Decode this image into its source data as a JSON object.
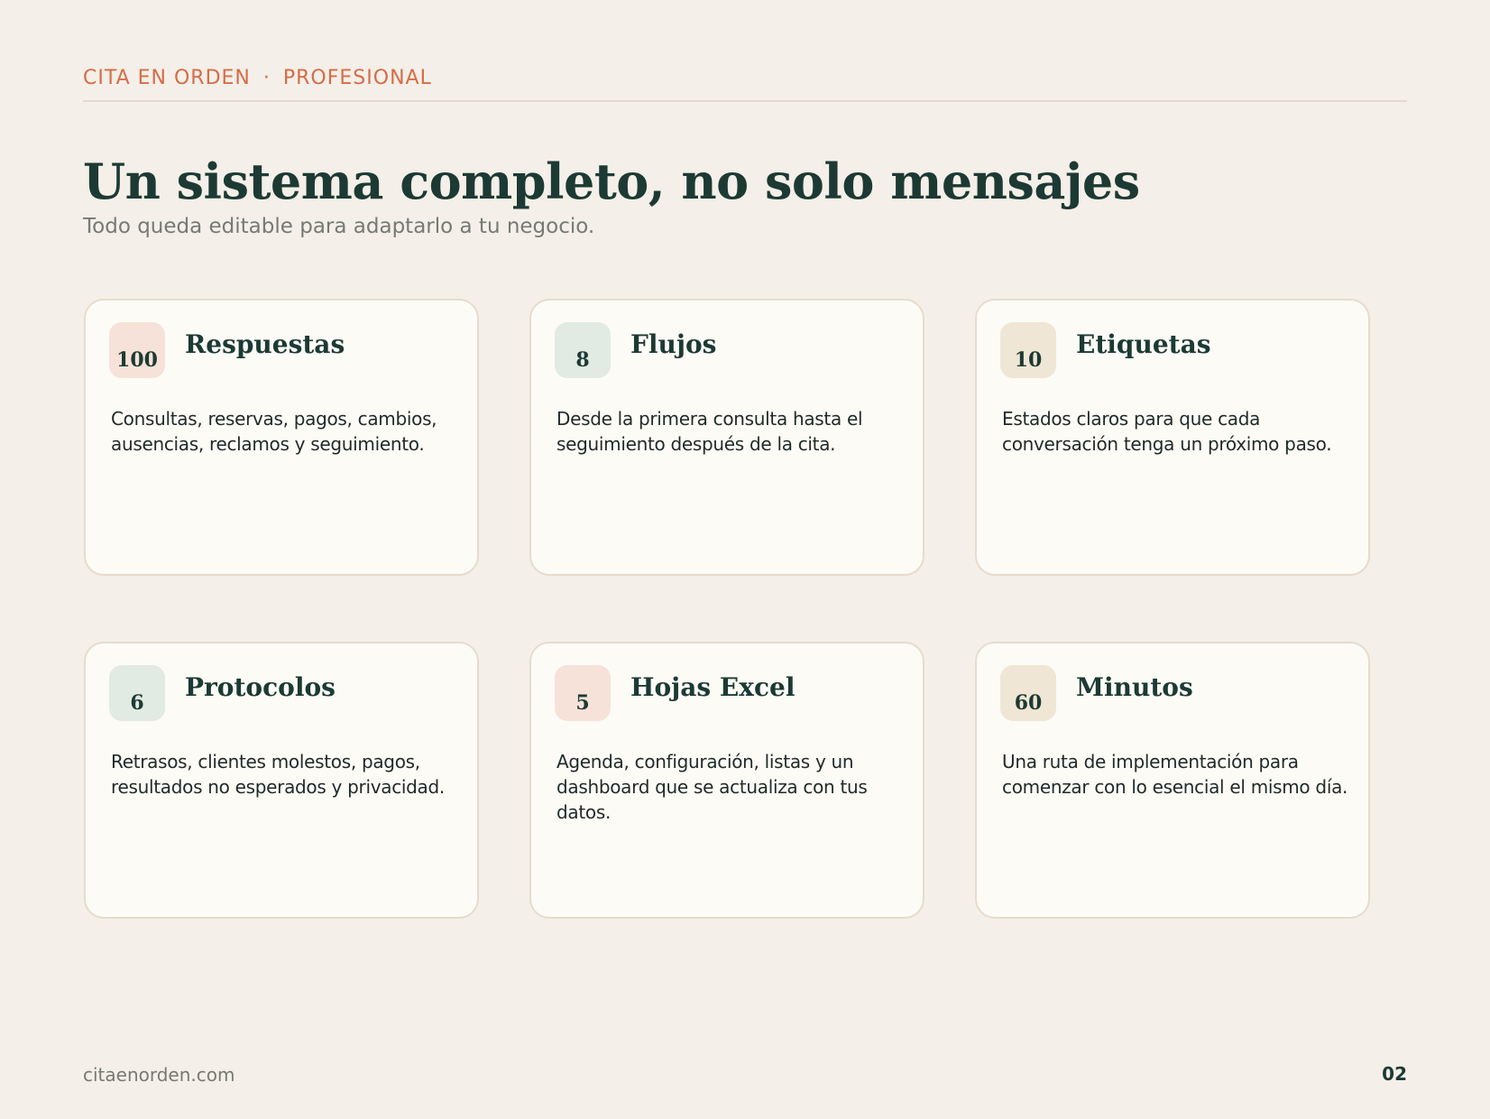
{
  "header": {
    "brand": "CITA EN ORDEN",
    "separator": "·",
    "tier": "PROFESIONAL"
  },
  "title": "Un sistema completo, no solo mensajes",
  "subtitle": "Todo queda editable para adaptarlo a tu negocio.",
  "cards": [
    {
      "number": "100",
      "title": "Respuestas",
      "body": "Consultas, reservas, pagos, cambios, ausencias, reclamos y seguimiento.",
      "badge_color": "#f6e2d8"
    },
    {
      "number": "8",
      "title": "Flujos",
      "body": "Desde la primera consulta hasta el seguimiento después de la cita.",
      "badge_color": "#e2eae4"
    },
    {
      "number": "10",
      "title": "Etiquetas",
      "body": "Estados claros para que cada conversación tenga un próximo paso.",
      "badge_color": "#f0e6d5"
    },
    {
      "number": "6",
      "title": "Protocolos",
      "body": "Retrasos, clientes molestos, pagos, resultados no esperados y privacidad.",
      "badge_color": "#e2eae4"
    },
    {
      "number": "5",
      "title": "Hojas Excel",
      "body": "Agenda, configuración, listas y un dashboard que se actualiza con tus datos.",
      "badge_color": "#f6e2d8"
    },
    {
      "number": "60",
      "title": "Minutos",
      "body": "Una ruta de implementación para comenzar con lo esencial el mismo día.",
      "badge_color": "#f0e6d5"
    }
  ],
  "footer": {
    "url": "citaenorden.com",
    "page": "02"
  },
  "colors": {
    "background": "#f4efe8",
    "accent": "#d56c48",
    "heading": "#1c3a33",
    "card": "#fdfbf6"
  }
}
